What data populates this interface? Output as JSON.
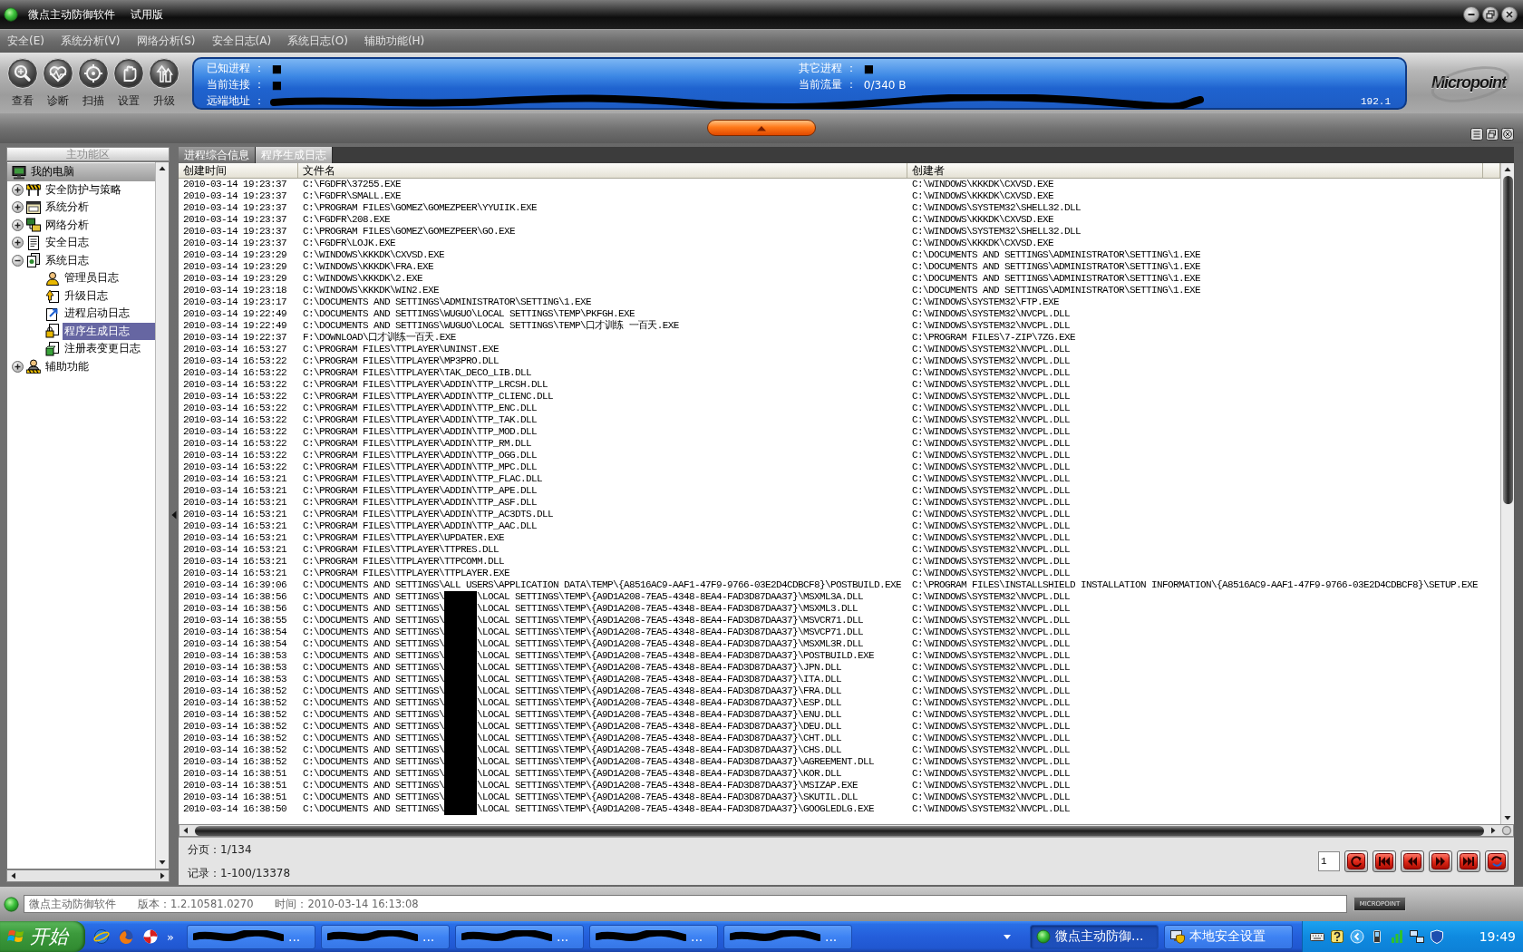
{
  "window": {
    "title": "微点主动防御软件",
    "edition": "试用版"
  },
  "menu": [
    "安全(E)",
    "系统分析(V)",
    "网络分析(S)",
    "安全日志(A)",
    "系统日志(O)",
    "辅助功能(H)"
  ],
  "toolbar": [
    {
      "label": "查看",
      "kind": "view"
    },
    {
      "label": "诊断",
      "kind": "diagnose"
    },
    {
      "label": "扫描",
      "kind": "scan"
    },
    {
      "label": "设置",
      "kind": "settings"
    },
    {
      "label": "升级",
      "kind": "upgrade"
    }
  ],
  "status_panel": {
    "left": [
      {
        "label": "已知进程 ：",
        "value": "■",
        "color": "#000000"
      },
      {
        "label": "当前连接 ：",
        "value": "■",
        "color": "#000000"
      }
    ],
    "right": [
      {
        "label": "其它进程 ：",
        "value": "■",
        "color": "#000000"
      },
      {
        "label": "当前流量 ：",
        "value": "0/340 B",
        "color": "#ffffff"
      }
    ],
    "remote": {
      "label": "远端地址 ：",
      "tail": "192.1"
    }
  },
  "logo": "Micropoint",
  "sidebar": {
    "header": "主功能区",
    "tree": [
      {
        "label": "我的电脑",
        "kind": "computer",
        "selected": false,
        "children": [
          {
            "label": "安全防护与策略",
            "kind": "policy",
            "expanded": false,
            "selected": false
          },
          {
            "label": "系统分析",
            "kind": "system",
            "expanded": false,
            "selected": false
          },
          {
            "label": "网络分析",
            "kind": "network",
            "expanded": false,
            "selected": false
          },
          {
            "label": "安全日志",
            "kind": "security-log",
            "expanded": false,
            "selected": false
          },
          {
            "label": "系统日志",
            "kind": "system-log",
            "expanded": true,
            "selected": false,
            "children": [
              {
                "label": "管理员日志",
                "kind": "admin-log",
                "selected": false
              },
              {
                "label": "升级日志",
                "kind": "upgrade-log",
                "selected": false
              },
              {
                "label": "进程启动日志",
                "kind": "process-log",
                "selected": false
              },
              {
                "label": "程序生成日志",
                "kind": "program-log",
                "selected": true
              },
              {
                "label": "注册表变更日志",
                "kind": "registry-log",
                "selected": false
              }
            ]
          },
          {
            "label": "辅助功能",
            "kind": "tools",
            "expanded": false,
            "selected": false
          }
        ]
      }
    ]
  },
  "tabs": [
    {
      "label": "进程综合信息",
      "selected": false
    },
    {
      "label": "程序生成日志",
      "selected": true
    }
  ],
  "table": {
    "columns": [
      "创建时间",
      "文件名",
      "创建者"
    ],
    "rows": [
      {
        "time": "2010-03-14 19:23:37",
        "file": "C:\\FGDFR\\37255.EXE",
        "creator": "C:\\WINDOWS\\KKKDK\\CXVSD.EXE"
      },
      {
        "time": "2010-03-14 19:23:37",
        "file": "C:\\FGDFR\\SMALL.EXE",
        "creator": "C:\\WINDOWS\\KKKDK\\CXVSD.EXE"
      },
      {
        "time": "2010-03-14 19:23:37",
        "file": "C:\\PROGRAM FILES\\GOMEZ\\GOMEZPEER\\YYUIIK.EXE",
        "creator": "C:\\WINDOWS\\SYSTEM32\\SHELL32.DLL"
      },
      {
        "time": "2010-03-14 19:23:37",
        "file": "C:\\FGDFR\\208.EXE",
        "creator": "C:\\WINDOWS\\KKKDK\\CXVSD.EXE"
      },
      {
        "time": "2010-03-14 19:23:37",
        "file": "C:\\PROGRAM FILES\\GOMEZ\\GOMEZPEER\\GO.EXE",
        "creator": "C:\\WINDOWS\\SYSTEM32\\SHELL32.DLL"
      },
      {
        "time": "2010-03-14 19:23:37",
        "file": "C:\\FGDFR\\LOJK.EXE",
        "creator": "C:\\WINDOWS\\KKKDK\\CXVSD.EXE"
      },
      {
        "time": "2010-03-14 19:23:29",
        "file": "C:\\WINDOWS\\KKKDK\\CXVSD.EXE",
        "creator": "C:\\DOCUMENTS AND SETTINGS\\ADMINISTRATOR\\SETTING\\1.EXE"
      },
      {
        "time": "2010-03-14 19:23:29",
        "file": "C:\\WINDOWS\\KKKDK\\FRA.EXE",
        "creator": "C:\\DOCUMENTS AND SETTINGS\\ADMINISTRATOR\\SETTING\\1.EXE"
      },
      {
        "time": "2010-03-14 19:23:29",
        "file": "C:\\WINDOWS\\KKKDK\\2.EXE",
        "creator": "C:\\DOCUMENTS AND SETTINGS\\ADMINISTRATOR\\SETTING\\1.EXE"
      },
      {
        "time": "2010-03-14 19:23:18",
        "file": "C:\\WINDOWS\\KKKDK\\WIN2.EXE",
        "creator": "C:\\DOCUMENTS AND SETTINGS\\ADMINISTRATOR\\SETTING\\1.EXE"
      },
      {
        "time": "2010-03-14 19:23:17",
        "file": "C:\\DOCUMENTS AND SETTINGS\\ADMINISTRATOR\\SETTING\\1.EXE",
        "creator": "C:\\WINDOWS\\SYSTEM32\\FTP.EXE"
      },
      {
        "time": "2010-03-14 19:22:49",
        "file": "C:\\DOCUMENTS AND SETTINGS\\WUGUO\\LOCAL SETTINGS\\TEMP\\PKFGH.EXE",
        "creator": "C:\\WINDOWS\\SYSTEM32\\NVCPL.DLL"
      },
      {
        "time": "2010-03-14 19:22:49",
        "file": "C:\\DOCUMENTS AND SETTINGS\\WUGUO\\LOCAL SETTINGS\\TEMP\\口才训练 一百天.EXE",
        "creator": "C:\\WINDOWS\\SYSTEM32\\NVCPL.DLL"
      },
      {
        "time": "2010-03-14 19:22:37",
        "file": "F:\\DOWNLOAD\\口才训练一百天.EXE",
        "creator": "C:\\PROGRAM FILES\\7-ZIP\\7ZG.EXE"
      },
      {
        "time": "2010-03-14 16:53:27",
        "file": "C:\\PROGRAM FILES\\TTPLAYER\\UNINST.EXE",
        "creator": "C:\\WINDOWS\\SYSTEM32\\NVCPL.DLL"
      },
      {
        "time": "2010-03-14 16:53:22",
        "file": "C:\\PROGRAM FILES\\TTPLAYER\\MP3PRO.DLL",
        "creator": "C:\\WINDOWS\\SYSTEM32\\NVCPL.DLL"
      },
      {
        "time": "2010-03-14 16:53:22",
        "file": "C:\\PROGRAM FILES\\TTPLAYER\\TAK_DECO_LIB.DLL",
        "creator": "C:\\WINDOWS\\SYSTEM32\\NVCPL.DLL"
      },
      {
        "time": "2010-03-14 16:53:22",
        "file": "C:\\PROGRAM FILES\\TTPLAYER\\ADDIN\\TTP_LRCSH.DLL",
        "creator": "C:\\WINDOWS\\SYSTEM32\\NVCPL.DLL"
      },
      {
        "time": "2010-03-14 16:53:22",
        "file": "C:\\PROGRAM FILES\\TTPLAYER\\ADDIN\\TTP_CLIENC.DLL",
        "creator": "C:\\WINDOWS\\SYSTEM32\\NVCPL.DLL"
      },
      {
        "time": "2010-03-14 16:53:22",
        "file": "C:\\PROGRAM FILES\\TTPLAYER\\ADDIN\\TTP_ENC.DLL",
        "creator": "C:\\WINDOWS\\SYSTEM32\\NVCPL.DLL"
      },
      {
        "time": "2010-03-14 16:53:22",
        "file": "C:\\PROGRAM FILES\\TTPLAYER\\ADDIN\\TTP_TAK.DLL",
        "creator": "C:\\WINDOWS\\SYSTEM32\\NVCPL.DLL"
      },
      {
        "time": "2010-03-14 16:53:22",
        "file": "C:\\PROGRAM FILES\\TTPLAYER\\ADDIN\\TTP_MOD.DLL",
        "creator": "C:\\WINDOWS\\SYSTEM32\\NVCPL.DLL"
      },
      {
        "time": "2010-03-14 16:53:22",
        "file": "C:\\PROGRAM FILES\\TTPLAYER\\ADDIN\\TTP_RM.DLL",
        "creator": "C:\\WINDOWS\\SYSTEM32\\NVCPL.DLL"
      },
      {
        "time": "2010-03-14 16:53:22",
        "file": "C:\\PROGRAM FILES\\TTPLAYER\\ADDIN\\TTP_OGG.DLL",
        "creator": "C:\\WINDOWS\\SYSTEM32\\NVCPL.DLL"
      },
      {
        "time": "2010-03-14 16:53:22",
        "file": "C:\\PROGRAM FILES\\TTPLAYER\\ADDIN\\TTP_MPC.DLL",
        "creator": "C:\\WINDOWS\\SYSTEM32\\NVCPL.DLL"
      },
      {
        "time": "2010-03-14 16:53:21",
        "file": "C:\\PROGRAM FILES\\TTPLAYER\\ADDIN\\TTP_FLAC.DLL",
        "creator": "C:\\WINDOWS\\SYSTEM32\\NVCPL.DLL"
      },
      {
        "time": "2010-03-14 16:53:21",
        "file": "C:\\PROGRAM FILES\\TTPLAYER\\ADDIN\\TTP_APE.DLL",
        "creator": "C:\\WINDOWS\\SYSTEM32\\NVCPL.DLL"
      },
      {
        "time": "2010-03-14 16:53:21",
        "file": "C:\\PROGRAM FILES\\TTPLAYER\\ADDIN\\TTP_ASF.DLL",
        "creator": "C:\\WINDOWS\\SYSTEM32\\NVCPL.DLL"
      },
      {
        "time": "2010-03-14 16:53:21",
        "file": "C:\\PROGRAM FILES\\TTPLAYER\\ADDIN\\TTP_AC3DTS.DLL",
        "creator": "C:\\WINDOWS\\SYSTEM32\\NVCPL.DLL"
      },
      {
        "time": "2010-03-14 16:53:21",
        "file": "C:\\PROGRAM FILES\\TTPLAYER\\ADDIN\\TTP_AAC.DLL",
        "creator": "C:\\WINDOWS\\SYSTEM32\\NVCPL.DLL"
      },
      {
        "time": "2010-03-14 16:53:21",
        "file": "C:\\PROGRAM FILES\\TTPLAYER\\UPDATER.EXE",
        "creator": "C:\\WINDOWS\\SYSTEM32\\NVCPL.DLL"
      },
      {
        "time": "2010-03-14 16:53:21",
        "file": "C:\\PROGRAM FILES\\TTPLAYER\\TTPRES.DLL",
        "creator": "C:\\WINDOWS\\SYSTEM32\\NVCPL.DLL"
      },
      {
        "time": "2010-03-14 16:53:21",
        "file": "C:\\PROGRAM FILES\\TTPLAYER\\TTPCOMM.DLL",
        "creator": "C:\\WINDOWS\\SYSTEM32\\NVCPL.DLL"
      },
      {
        "time": "2010-03-14 16:53:21",
        "file": "C:\\PROGRAM FILES\\TTPLAYER\\TTPLAYER.EXE",
        "creator": "C:\\WINDOWS\\SYSTEM32\\NVCPL.DLL"
      },
      {
        "time": "2010-03-14 16:39:06",
        "file": "C:\\DOCUMENTS AND SETTINGS\\ALL USERS\\APPLICATION DATA\\TEMP\\{A8516AC9-AAF1-47F9-9766-03E2D4CDBCF8}\\POSTBUILD.EXE",
        "creator": "C:\\PROGRAM FILES\\INSTALLSHIELD INSTALLATION INFORMATION\\{A8516AC9-AAF1-47F9-9766-03E2D4CDBCF8}\\SETUP.EXE"
      },
      {
        "time": "2010-03-14 16:38:56",
        "file": [
          "C:\\DOCUMENTS AND SETTINGS\\",
          "\\LOCAL SETTINGS\\TEMP\\{A9D1A208-7EA5-4348-8EA4-FAD3D87DAA37}\\MSXML3A.DLL"
        ],
        "creator": "C:\\WINDOWS\\SYSTEM32\\NVCPL.DLL"
      },
      {
        "time": "2010-03-14 16:38:56",
        "file": [
          "C:\\DOCUMENTS AND SETTINGS\\",
          "\\LOCAL SETTINGS\\TEMP\\{A9D1A208-7EA5-4348-8EA4-FAD3D87DAA37}\\MSXML3.DLL"
        ],
        "creator": "C:\\WINDOWS\\SYSTEM32\\NVCPL.DLL"
      },
      {
        "time": "2010-03-14 16:38:55",
        "file": [
          "C:\\DOCUMENTS AND SETTINGS\\",
          "\\LOCAL SETTINGS\\TEMP\\{A9D1A208-7EA5-4348-8EA4-FAD3D87DAA37}\\MSVCR71.DLL"
        ],
        "creator": "C:\\WINDOWS\\SYSTEM32\\NVCPL.DLL"
      },
      {
        "time": "2010-03-14 16:38:54",
        "file": [
          "C:\\DOCUMENTS AND SETTINGS\\",
          "\\LOCAL SETTINGS\\TEMP\\{A9D1A208-7EA5-4348-8EA4-FAD3D87DAA37}\\MSVCP71.DLL"
        ],
        "creator": "C:\\WINDOWS\\SYSTEM32\\NVCPL.DLL"
      },
      {
        "time": "2010-03-14 16:38:54",
        "file": [
          "C:\\DOCUMENTS AND SETTINGS\\",
          "\\LOCAL SETTINGS\\TEMP\\{A9D1A208-7EA5-4348-8EA4-FAD3D87DAA37}\\MSXML3R.DLL"
        ],
        "creator": "C:\\WINDOWS\\SYSTEM32\\NVCPL.DLL"
      },
      {
        "time": "2010-03-14 16:38:53",
        "file": [
          "C:\\DOCUMENTS AND SETTINGS\\",
          "\\LOCAL SETTINGS\\TEMP\\{A9D1A208-7EA5-4348-8EA4-FAD3D87DAA37}\\POSTBUILD.EXE"
        ],
        "creator": "C:\\WINDOWS\\SYSTEM32\\NVCPL.DLL"
      },
      {
        "time": "2010-03-14 16:38:53",
        "file": [
          "C:\\DOCUMENTS AND SETTINGS\\",
          "\\LOCAL SETTINGS\\TEMP\\{A9D1A208-7EA5-4348-8EA4-FAD3D87DAA37}\\JPN.DLL"
        ],
        "creator": "C:\\WINDOWS\\SYSTEM32\\NVCPL.DLL"
      },
      {
        "time": "2010-03-14 16:38:53",
        "file": [
          "C:\\DOCUMENTS AND SETTINGS\\",
          "\\LOCAL SETTINGS\\TEMP\\{A9D1A208-7EA5-4348-8EA4-FAD3D87DAA37}\\ITA.DLL"
        ],
        "creator": "C:\\WINDOWS\\SYSTEM32\\NVCPL.DLL"
      },
      {
        "time": "2010-03-14 16:38:52",
        "file": [
          "C:\\DOCUMENTS AND SETTINGS\\",
          "\\LOCAL SETTINGS\\TEMP\\{A9D1A208-7EA5-4348-8EA4-FAD3D87DAA37}\\FRA.DLL"
        ],
        "creator": "C:\\WINDOWS\\SYSTEM32\\NVCPL.DLL"
      },
      {
        "time": "2010-03-14 16:38:52",
        "file": [
          "C:\\DOCUMENTS AND SETTINGS\\",
          "\\LOCAL SETTINGS\\TEMP\\{A9D1A208-7EA5-4348-8EA4-FAD3D87DAA37}\\ESP.DLL"
        ],
        "creator": "C:\\WINDOWS\\SYSTEM32\\NVCPL.DLL"
      },
      {
        "time": "2010-03-14 16:38:52",
        "file": [
          "C:\\DOCUMENTS AND SETTINGS\\",
          "\\LOCAL SETTINGS\\TEMP\\{A9D1A208-7EA5-4348-8EA4-FAD3D87DAA37}\\ENU.DLL"
        ],
        "creator": "C:\\WINDOWS\\SYSTEM32\\NVCPL.DLL"
      },
      {
        "time": "2010-03-14 16:38:52",
        "file": [
          "C:\\DOCUMENTS AND SETTINGS\\",
          "\\LOCAL SETTINGS\\TEMP\\{A9D1A208-7EA5-4348-8EA4-FAD3D87DAA37}\\DEU.DLL"
        ],
        "creator": "C:\\WINDOWS\\SYSTEM32\\NVCPL.DLL"
      },
      {
        "time": "2010-03-14 16:38:52",
        "file": [
          "C:\\DOCUMENTS AND SETTINGS\\",
          "\\LOCAL SETTINGS\\TEMP\\{A9D1A208-7EA5-4348-8EA4-FAD3D87DAA37}\\CHT.DLL"
        ],
        "creator": "C:\\WINDOWS\\SYSTEM32\\NVCPL.DLL"
      },
      {
        "time": "2010-03-14 16:38:52",
        "file": [
          "C:\\DOCUMENTS AND SETTINGS\\",
          "\\LOCAL SETTINGS\\TEMP\\{A9D1A208-7EA5-4348-8EA4-FAD3D87DAA37}\\CHS.DLL"
        ],
        "creator": "C:\\WINDOWS\\SYSTEM32\\NVCPL.DLL"
      },
      {
        "time": "2010-03-14 16:38:52",
        "file": [
          "C:\\DOCUMENTS AND SETTINGS\\",
          "\\LOCAL SETTINGS\\TEMP\\{A9D1A208-7EA5-4348-8EA4-FAD3D87DAA37}\\AGREEMENT.DLL"
        ],
        "creator": "C:\\WINDOWS\\SYSTEM32\\NVCPL.DLL"
      },
      {
        "time": "2010-03-14 16:38:51",
        "file": [
          "C:\\DOCUMENTS AND SETTINGS\\",
          "\\LOCAL SETTINGS\\TEMP\\{A9D1A208-7EA5-4348-8EA4-FAD3D87DAA37}\\KOR.DLL"
        ],
        "creator": "C:\\WINDOWS\\SYSTEM32\\NVCPL.DLL"
      },
      {
        "time": "2010-03-14 16:38:51",
        "file": [
          "C:\\DOCUMENTS AND SETTINGS\\",
          "\\LOCAL SETTINGS\\TEMP\\{A9D1A208-7EA5-4348-8EA4-FAD3D87DAA37}\\MSIZAP.EXE"
        ],
        "creator": "C:\\WINDOWS\\SYSTEM32\\NVCPL.DLL"
      },
      {
        "time": "2010-03-14 16:38:51",
        "file": [
          "C:\\DOCUMENTS AND SETTINGS\\",
          "\\LOCAL SETTINGS\\TEMP\\{A9D1A208-7EA5-4348-8EA4-FAD3D87DAA37}\\SKUTIL.DLL"
        ],
        "creator": "C:\\WINDOWS\\SYSTEM32\\NVCPL.DLL"
      },
      {
        "time": "2010-03-14 16:38:50",
        "file": [
          "C:\\DOCUMENTS AND SETTINGS\\",
          "\\LOCAL SETTINGS\\TEMP\\{A9D1A208-7EA5-4348-8EA4-FAD3D87DAA37}\\GOOGLEDLG.EXE"
        ],
        "creator": "C:\\WINDOWS\\SYSTEM32\\NVCPL.DLL"
      }
    ]
  },
  "pager": {
    "page": "分页：1/134",
    "records": "记录：1-100/13378",
    "page_input": "1"
  },
  "status_bar": {
    "app": "微点主动防御软件",
    "version": "版本：1.2.10581.0270",
    "time": "时间：2010-03-14 16:13:08",
    "badge": "MICROPOINT"
  },
  "taskbar": {
    "start": "开始",
    "more": "»",
    "tasks": [
      {
        "kind": "redacted",
        "label": "...",
        "selected": false
      },
      {
        "kind": "redacted",
        "label": "...",
        "selected": false
      },
      {
        "kind": "redacted",
        "label": "...",
        "selected": false
      },
      {
        "kind": "redacted",
        "label": "...",
        "selected": false
      },
      {
        "kind": "redacted",
        "label": "...",
        "selected": false
      },
      {
        "kind": "app",
        "label": "微点主动防御...",
        "selected": true
      },
      {
        "kind": "settings",
        "label": "本地安全设置",
        "selected": false
      }
    ],
    "clock": "19:49"
  }
}
